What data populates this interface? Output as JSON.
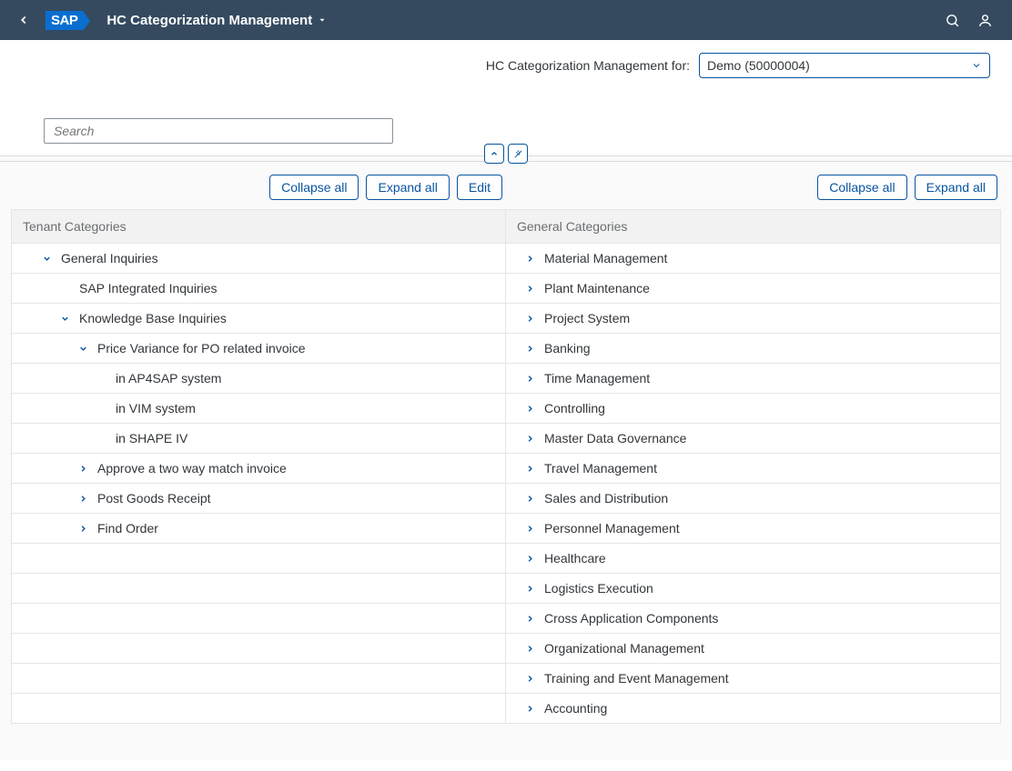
{
  "header": {
    "logo_text": "SAP",
    "title": "HC Categorization Management"
  },
  "filter": {
    "label": "HC Categorization Management for:",
    "selected": "Demo (50000004)"
  },
  "search": {
    "placeholder": "Search"
  },
  "actions": {
    "collapse_all": "Collapse all",
    "expand_all": "Expand all",
    "edit": "Edit"
  },
  "left": {
    "header": "Tenant Categories",
    "rows": [
      {
        "label": "General Inquiries",
        "indent": 1,
        "icon": "down"
      },
      {
        "label": "SAP Integrated Inquiries",
        "indent": "1n",
        "icon": "none"
      },
      {
        "label": "Knowledge Base Inquiries",
        "indent": 2,
        "icon": "down"
      },
      {
        "label": "Price Variance for PO related invoice",
        "indent": 3,
        "icon": "down"
      },
      {
        "label": "in AP4SAP system",
        "indent": 4,
        "icon": "none"
      },
      {
        "label": "in VIM system",
        "indent": 4,
        "icon": "none"
      },
      {
        "label": "in SHAPE IV",
        "indent": 4,
        "icon": "none"
      },
      {
        "label": "Approve a two way match invoice",
        "indent": 3,
        "icon": "right"
      },
      {
        "label": "Post Goods Receipt",
        "indent": 3,
        "icon": "right"
      },
      {
        "label": "Find Order",
        "indent": 3,
        "icon": "right"
      },
      {
        "label": "",
        "indent": 1,
        "icon": "none"
      },
      {
        "label": "",
        "indent": 1,
        "icon": "none"
      },
      {
        "label": "",
        "indent": 1,
        "icon": "none"
      },
      {
        "label": "",
        "indent": 1,
        "icon": "none"
      },
      {
        "label": "",
        "indent": 1,
        "icon": "none"
      },
      {
        "label": "",
        "indent": 1,
        "icon": "none"
      }
    ]
  },
  "right": {
    "header": "General Categories",
    "rows": [
      {
        "label": "Material Management"
      },
      {
        "label": "Plant Maintenance"
      },
      {
        "label": "Project System"
      },
      {
        "label": "Banking"
      },
      {
        "label": "Time Management"
      },
      {
        "label": "Controlling"
      },
      {
        "label": "Master Data Governance"
      },
      {
        "label": "Travel Management"
      },
      {
        "label": "Sales and Distribution"
      },
      {
        "label": "Personnel Management"
      },
      {
        "label": "Healthcare"
      },
      {
        "label": "Logistics Execution"
      },
      {
        "label": "Cross Application Components"
      },
      {
        "label": "Organizational Management"
      },
      {
        "label": "Training and Event Management"
      },
      {
        "label": "Accounting"
      }
    ]
  }
}
